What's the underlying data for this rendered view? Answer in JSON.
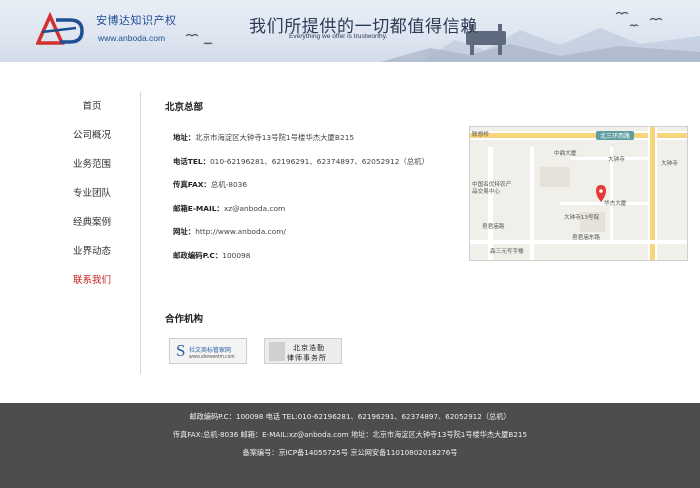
{
  "header": {
    "logo_mark_text": "AD",
    "logo_name": "安博达知识产权",
    "logo_url": "www.anboda.com",
    "slogan_cn": "我们所提供的一切都值得信赖",
    "slogan_en": "Everything we offer is trustworthy."
  },
  "colors": {
    "active_nav": "#c01b1b",
    "footer_bg": "#4d4d4d",
    "brand_blue": "#1f4f93",
    "brand_red": "#d32f2f"
  },
  "sidebar": {
    "items": [
      {
        "label": "首页"
      },
      {
        "label": "公司概况"
      },
      {
        "label": "业务范围"
      },
      {
        "label": "专业团队"
      },
      {
        "label": "经典案例"
      },
      {
        "label": "业界动态"
      },
      {
        "label": "联系我们",
        "active": true
      }
    ]
  },
  "main": {
    "title": "北京总部",
    "address_label": "地址：",
    "address_value": "北京市海淀区大钟寺13号院1号楼华杰大厦B215",
    "tel_label": "电话TEL：",
    "tel_value": "010-62196281、62196291、62374897、62052912（总机）",
    "fax_label": "传真FAX：",
    "fax_value": "总机-8036",
    "email_label": "邮箱E-MAIL：",
    "email_value": "xz@anboda.com",
    "web_label": "网址：",
    "web_value": "http://www.anboda.com/",
    "postcode_label": "邮政编码P.C：",
    "postcode_value": "100098"
  },
  "map": {
    "labels": {
      "lianxiang_bridge": "联想桥",
      "north_third_ring": "北三环西路",
      "zhongguancun_tower": "中鼎大厦",
      "dazhongsi": "大钟寺",
      "dazhongsi_right": "大钟寺",
      "school": "中国名优特农产品交易中心",
      "huajie": "华杰大厦",
      "dazhongsi13": "大钟寺13号院",
      "zaojun_road": "皂君庙路",
      "zaojun_east": "皂君庙东路",
      "sanyuan": "森三元写字楼"
    }
  },
  "partners": {
    "title": "合作机构",
    "p1_letter": "S",
    "p1_name": "社文商标管家网",
    "p1_url": "www.shewentm.com",
    "p2_line1": "北京浩勤",
    "p2_line2": "律师事务所"
  },
  "footer": {
    "line1": "邮政编码P.C：100098 电话 TEL:010-62196281、62196291、62374897、62052912（总机）",
    "line2": "传真FAX:总机-8036 邮箱：E-MAIL:xz@anboda.com 地址：北京市海淀区大钟寺13号院1号楼华杰大厦B215",
    "line3": "备案编号：京ICP备14055725号 京公网安备11010802018276号"
  }
}
